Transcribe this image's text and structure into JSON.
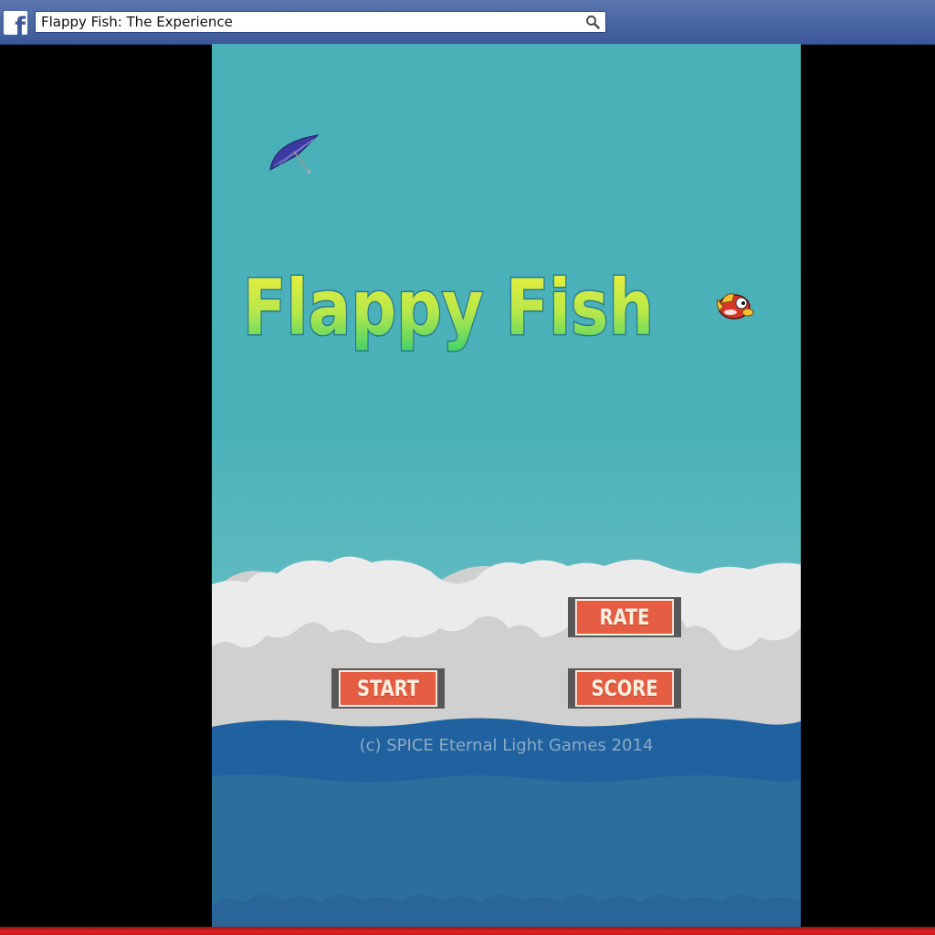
{
  "browser": {
    "title_value": "Flappy Fish: The Experience",
    "logo_letter": "f",
    "icons": {
      "logo": "facebook-logo-icon",
      "search": "search-icon"
    }
  },
  "game": {
    "title": "Flappy Fish",
    "buttons": {
      "start": "START",
      "rate": "RATE",
      "score": "SCORE"
    },
    "copyright": "(c) SPICE Eternal Light Games 2014",
    "icons": {
      "umbrella": "umbrella-icon",
      "fish": "fish-character-icon"
    }
  },
  "colors": {
    "sky": "#4cb2b9",
    "clouds_front": "#ebebeb",
    "clouds_back": "#d0d0d0",
    "sea_top": "#2062a0",
    "sea": "#2d6f9c",
    "button": "#e55e44",
    "browser_bar": "#3b5998"
  }
}
